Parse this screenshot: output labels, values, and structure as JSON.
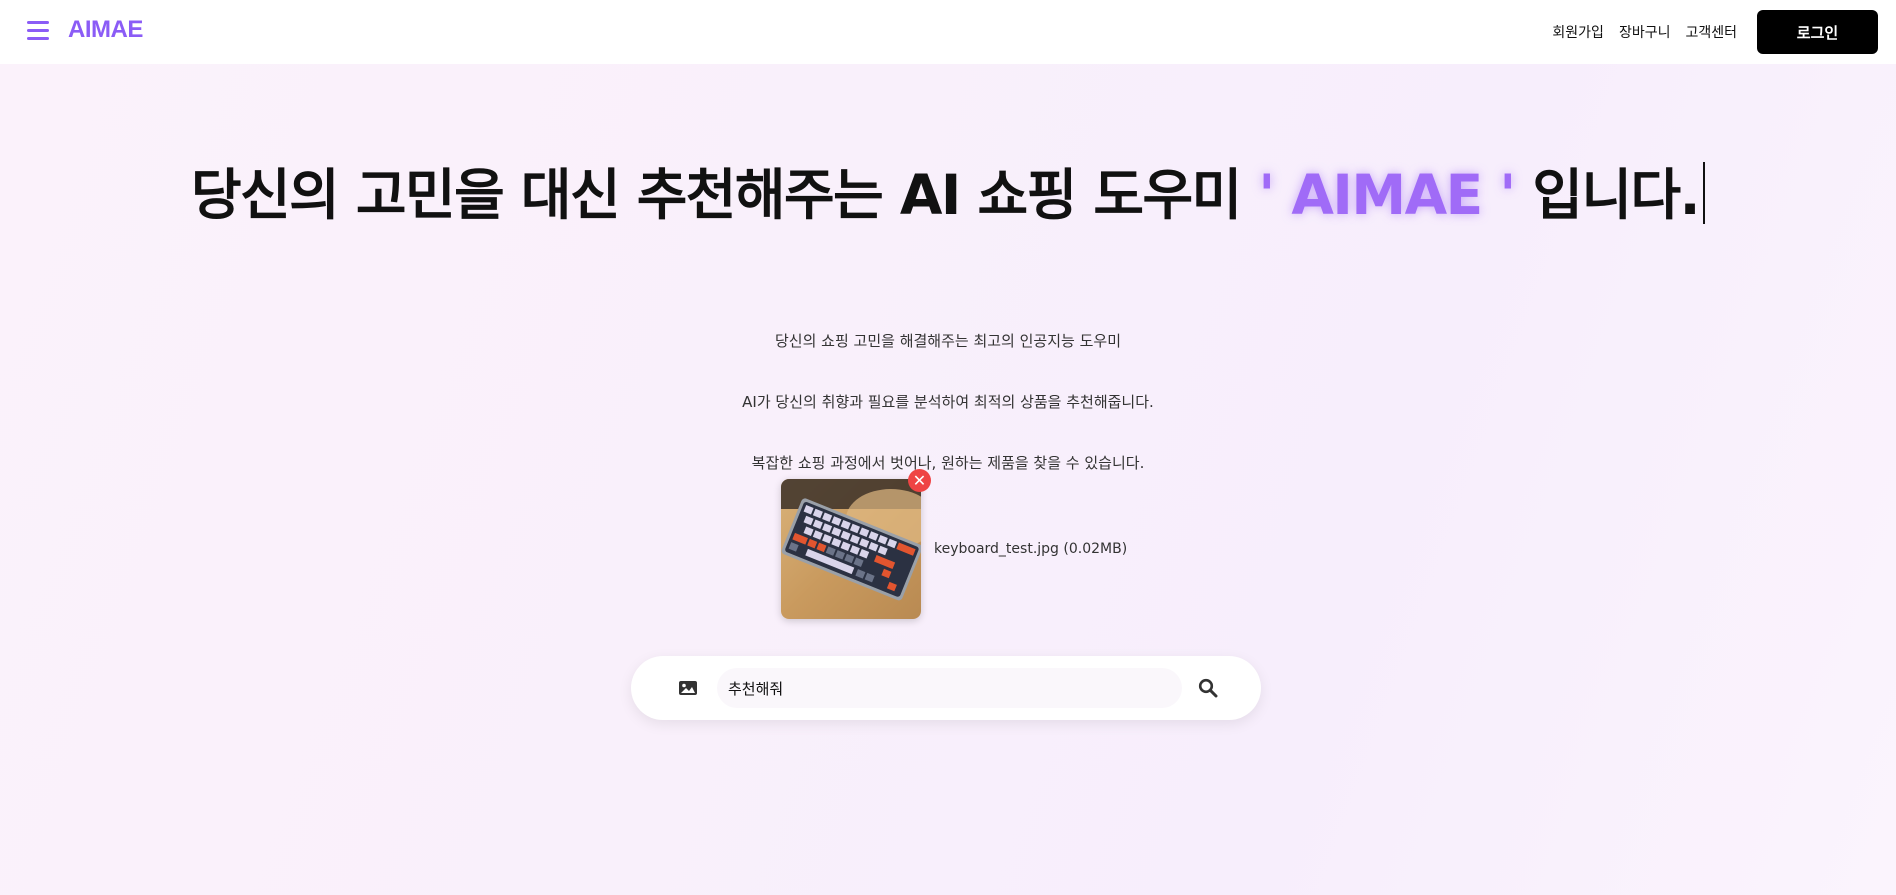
{
  "header": {
    "logo": "AIMAE",
    "nav": [
      "회원가입",
      "장바구니",
      "고객센터"
    ],
    "login_label": "로그인"
  },
  "hero": {
    "title_before": "당신의 고민을 대신 추천해주는 AI 쇼핑 도우미 ",
    "title_brand": "' AIMAE '",
    "title_after": " 입니다.",
    "lines": [
      "당신의 쇼핑 고민을 해결해주는 최고의 인공지능 도우미",
      "AI가 당신의 취향과 필요를 분석하여 최적의 상품을 추천해줍니다.",
      "복잡한 쇼핑 과정에서 벗어나, 원하는 제품을 찾을 수 있습니다."
    ]
  },
  "upload": {
    "file_label": "keyboard_test.jpg (0.02MB)",
    "remove_symbol": "✕"
  },
  "search": {
    "value": "추천해줘"
  },
  "colors": {
    "brand": "#8b5cf6",
    "brand_title": "#a06bf7",
    "remove": "#ef4444"
  }
}
